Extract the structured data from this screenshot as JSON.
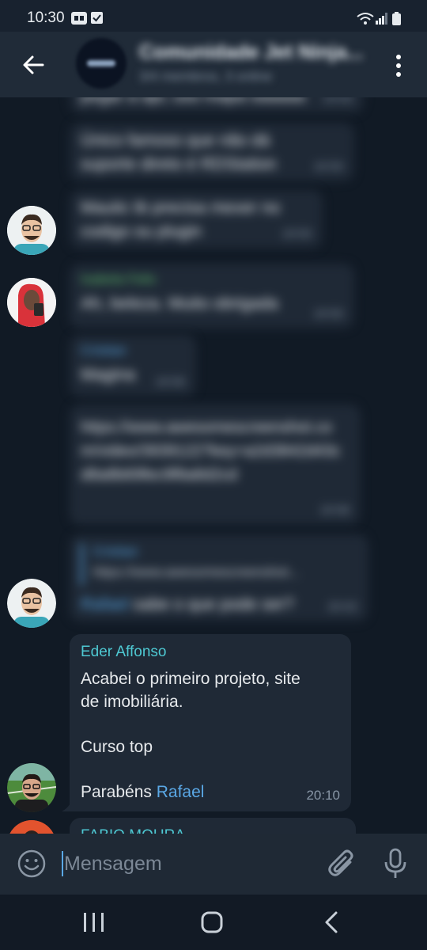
{
  "status_bar": {
    "time": "10:30",
    "icons": [
      "notification-icon",
      "check-icon",
      "wifi-icon",
      "signal-icon",
      "battery-icon"
    ]
  },
  "header": {
    "title": "Comunidade Jet Ninja...",
    "subtitle": "3/4 membros, 3 online"
  },
  "messages": {
    "m1": {
      "text": "pegar a api, uso mapa saaaaa",
      "time": "19:50"
    },
    "m2": {
      "text": "Único famoso que não dá suporte direto é RDStation",
      "time": "19:50"
    },
    "m3": {
      "text": "Mautic tb precisa mexer no codigo ou plugin",
      "time": "19:50"
    },
    "m4": {
      "sender": "Isabela Felix",
      "text": "Ah, beleza. Muito obrigada",
      "time": "19:50"
    },
    "m5": {
      "sender": "Cristian",
      "text": "Magina",
      "time": "19:56"
    },
    "m6": {
      "link": "https://www.awesomescreenshot.com/video/3939122?key=a2d3842d43cd8a8b69fec9f8a8d2cd",
      "time": "19:58"
    },
    "m7": {
      "quote_sender": "Cristian",
      "quote_text": "https://www.awesomescreenshot...",
      "mention": "Rafael",
      "text": "sabe o que pode ser?",
      "time": "20:02"
    },
    "m8": {
      "sender": "Eder Affonso",
      "line1": "Acabei o primeiro projeto,  site",
      "line2": "de imobiliária.",
      "line3": "Curso top",
      "line4_prefix": "Parabéns ",
      "line4_mention": "Rafael",
      "time": "20:10"
    },
    "m9": {
      "sender": "FABIO MOURA"
    }
  },
  "input": {
    "placeholder": "Mensagem"
  },
  "colors": {
    "accent": "#5aa8e6",
    "sender_green": "#5fbf6a",
    "sender_cyan": "#4ec8d2",
    "bubble": "#1f2936",
    "background": "#111a25"
  }
}
